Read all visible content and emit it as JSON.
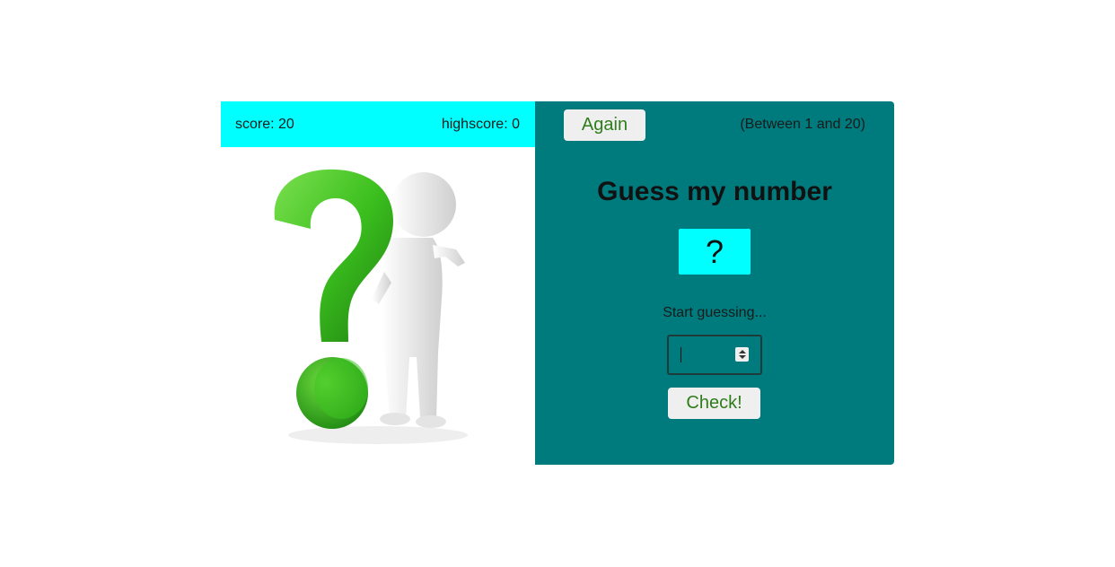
{
  "score_bar": {
    "score_text": "score: 20",
    "highscore_text": "highscore: 0"
  },
  "header": {
    "again_label": "Again",
    "range_hint": "(Between 1 and 20)"
  },
  "main": {
    "title": "Guess my number",
    "secret_number": "?",
    "message": "Start guessing...",
    "guess_input": {
      "value": "",
      "placeholder": ""
    },
    "check_label": "Check!"
  },
  "illustration": {
    "description_icon": "question-mark-figure-icon"
  },
  "colors": {
    "cyan": "#00ffff",
    "teal": "#007b7d",
    "button_text_green": "#2e7d1a",
    "question_green": "#3bbf1e"
  }
}
